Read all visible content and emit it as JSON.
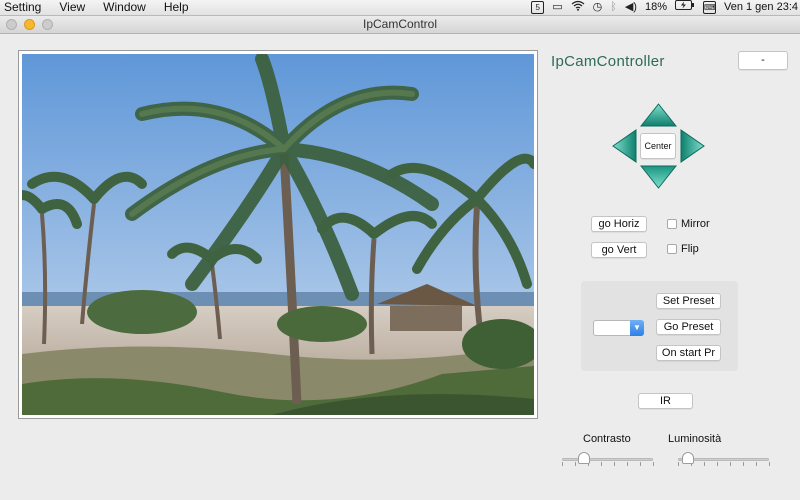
{
  "menubar": {
    "items": [
      "Setting",
      "View",
      "Window",
      "Help"
    ],
    "battery": "18%",
    "clock": "Ven 1 gen  23:4"
  },
  "window": {
    "title": "IpCamControl"
  },
  "app": {
    "title": "IpCamController",
    "dash_button": "-",
    "center_button": "Center",
    "go_horiz": "go Horiz",
    "go_vert": "go Vert",
    "mirror_label": "Mirror",
    "flip_label": "Flip",
    "set_preset": "Set Preset",
    "go_preset": "Go Preset",
    "on_start": "On start Pr",
    "ir_button": "IR",
    "contrasto_label": "Contrasto",
    "luminosita_label": "Luminosità",
    "contrasto_value": 0.2,
    "luminosita_value": 0.05
  },
  "colors": {
    "accent_teal": "#1f9a86",
    "title_green": "#2e6b55",
    "select_blue": "#2f7fe6"
  }
}
